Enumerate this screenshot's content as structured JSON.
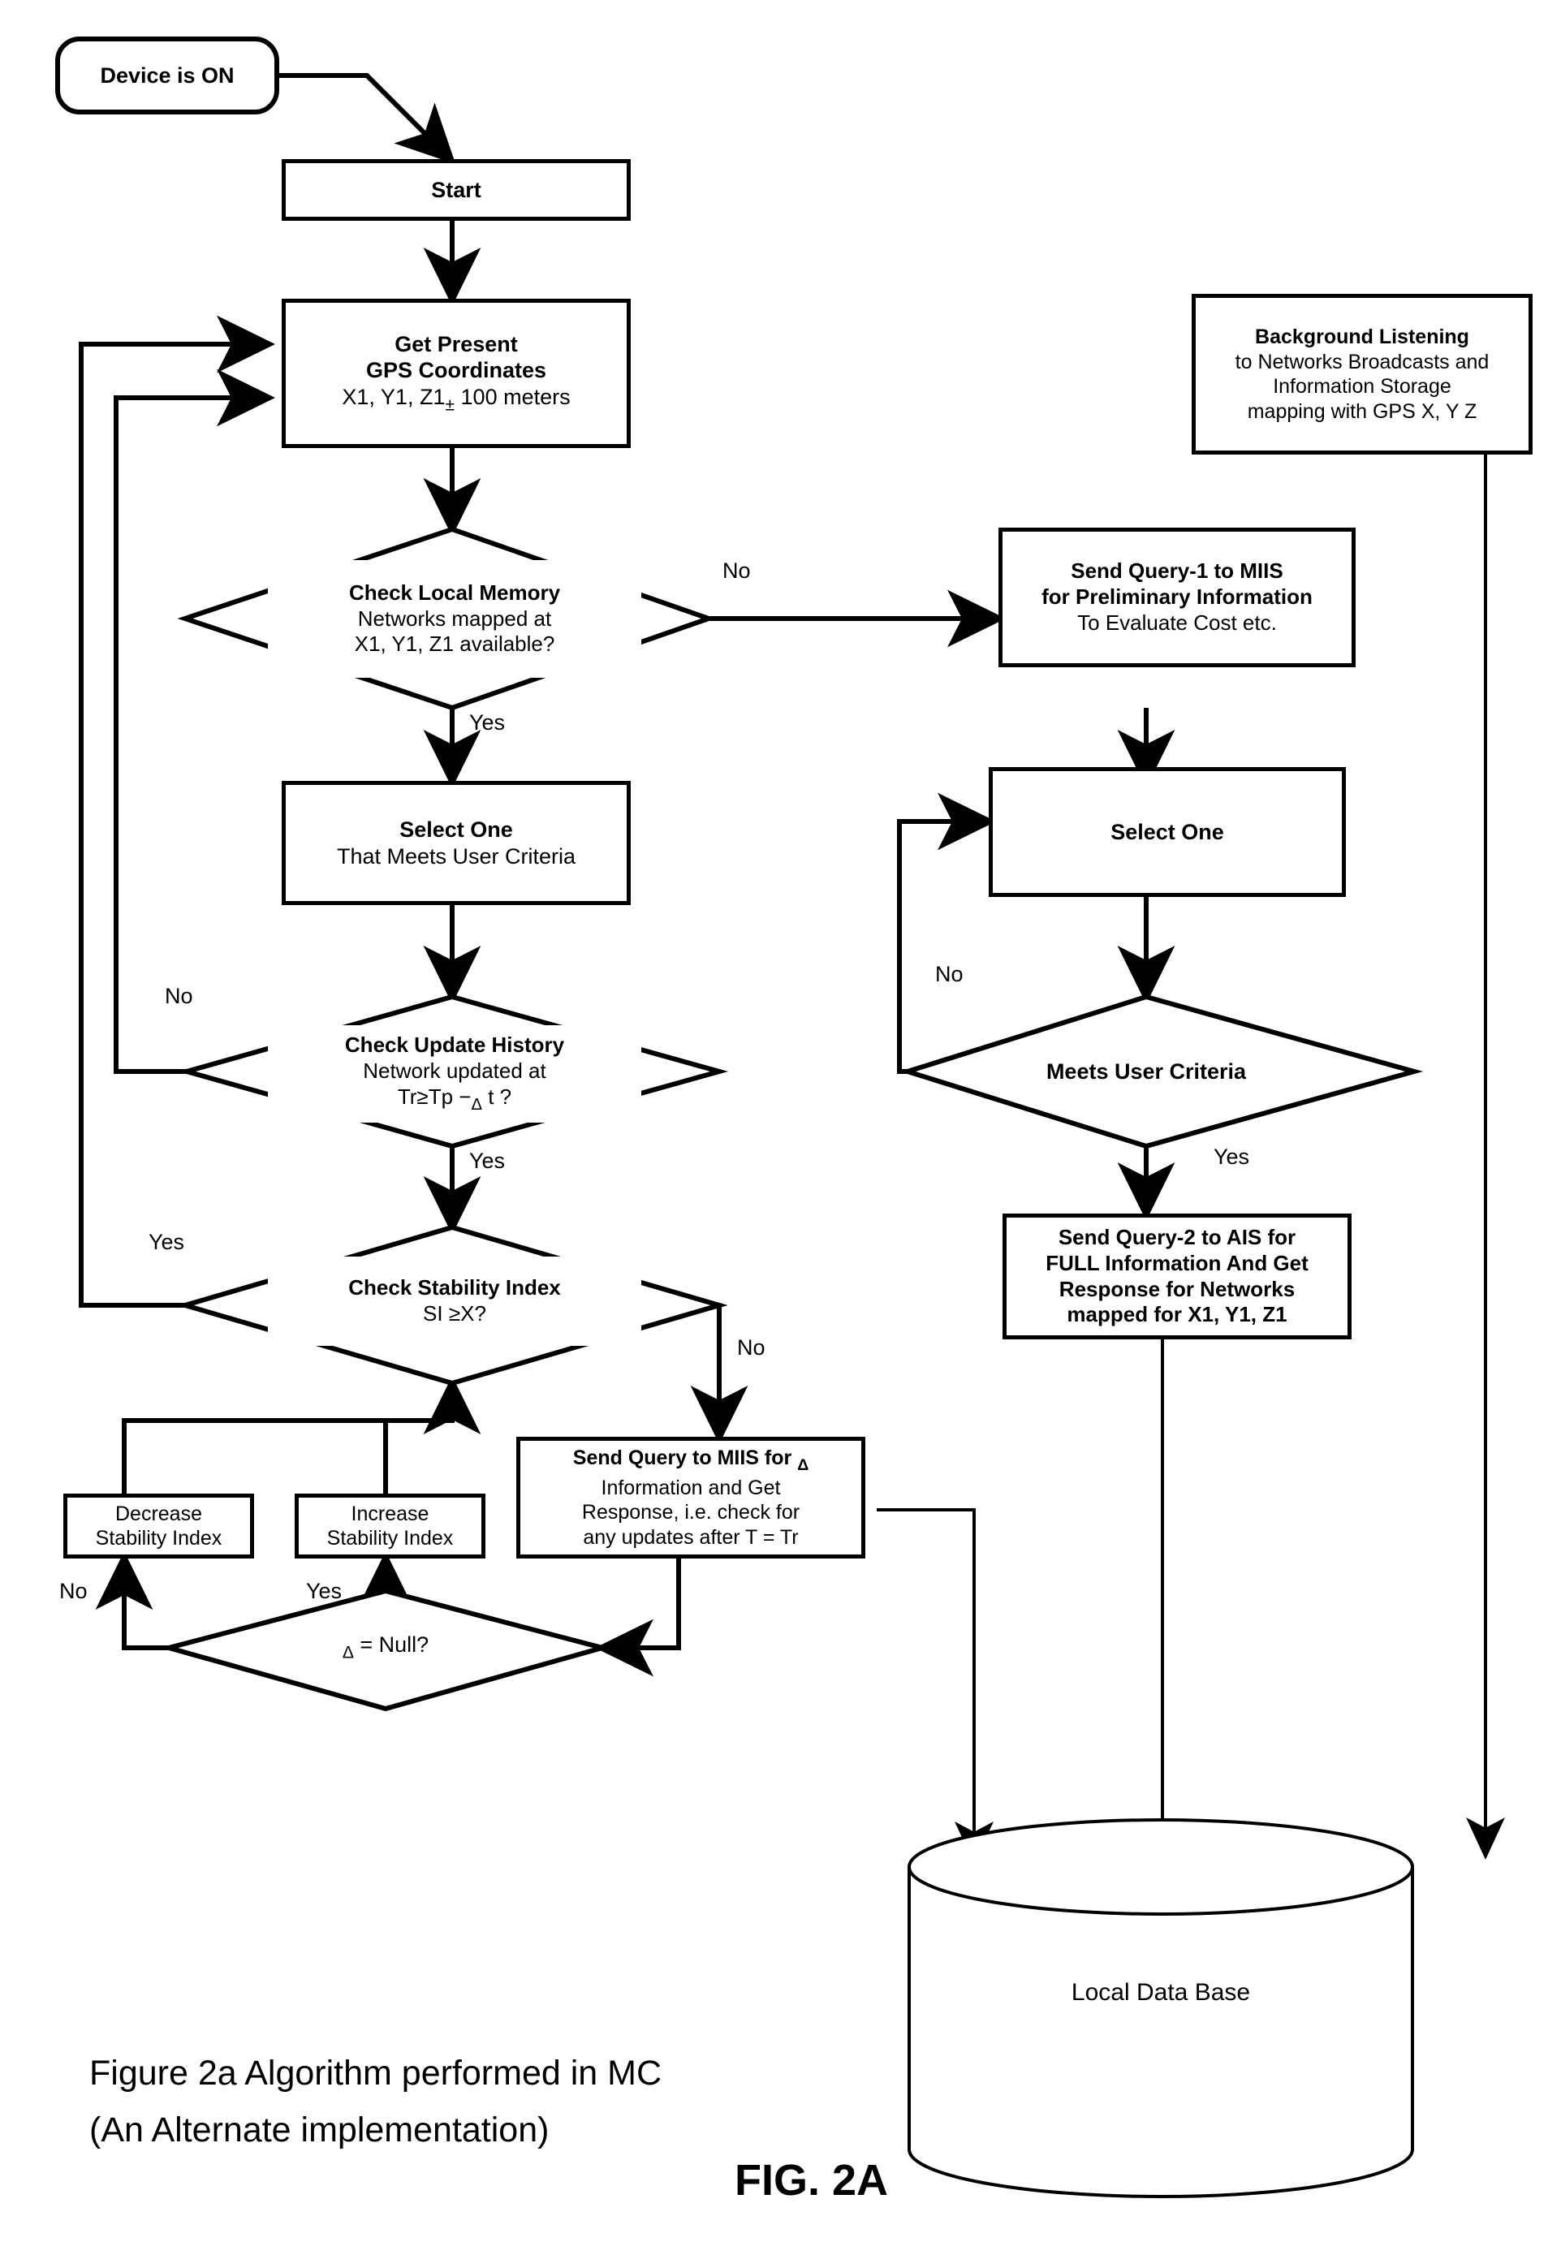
{
  "figure": {
    "caption_line1": "Figure 2a Algorithm performed in MC",
    "caption_line2": "(An Alternate implementation)",
    "fig_number": "FIG. 2A"
  },
  "nodes": {
    "device_on": {
      "label": "Device is ON",
      "shape": "terminator"
    },
    "start": {
      "label": "Start",
      "shape": "process"
    },
    "get_gps": {
      "line1": "Get Present",
      "line2": "GPS Coordinates",
      "line3_a": "X1, Y1, Z1",
      "line3_sym": "±",
      "line3_b": "100 meters",
      "shape": "process"
    },
    "check_local_memory": {
      "line1": "Check Local Memory",
      "line2": "Networks mapped at",
      "line3": "X1, Y1, Z1 available?",
      "shape": "decision"
    },
    "select_one_left": {
      "line1": "Select One",
      "line2": "That Meets User Criteria",
      "shape": "process"
    },
    "check_update_history": {
      "line1": "Check Update History",
      "line2": "Network updated at",
      "line3_a": "Tr",
      "line3_sym": "≥",
      "line3_b": "Tp −",
      "line3_delta": "Δ",
      "line3_c": "t ?",
      "shape": "decision"
    },
    "check_stability_index": {
      "line1": "Check Stability Index",
      "line2_a": "SI",
      "line2_sym": "≥",
      "line2_b": "X?",
      "shape": "decision"
    },
    "decrease_si": {
      "line1": "Decrease",
      "line2": "Stability Index",
      "shape": "process"
    },
    "increase_si": {
      "line1": "Increase",
      "line2": "Stability Index",
      "shape": "process"
    },
    "delta_null": {
      "delta": "Δ",
      "text": "= Null?",
      "shape": "decision"
    },
    "send_query_miis_delta": {
      "line1_a": "Send Query to MIIS for",
      "line1_delta": "Δ",
      "line2": "Information and Get",
      "line3": "Response, i.e. check for",
      "line4": "any updates after T = Tr",
      "shape": "process"
    },
    "background_listening": {
      "line1": "Background Listening",
      "line2": "to Networks Broadcasts and",
      "line3": "Information Storage",
      "line4": "mapping with GPS X, Y Z",
      "shape": "process"
    },
    "send_query_1": {
      "line1": "Send Query-1 to MIIS",
      "line2": "for Preliminary Information",
      "line3": "To Evaluate Cost etc.",
      "shape": "process"
    },
    "select_one_right": {
      "line1": "Select One",
      "shape": "process"
    },
    "meets_user_criteria": {
      "line1": "Meets User Criteria",
      "shape": "decision"
    },
    "send_query_2": {
      "line1": "Send Query-2 to AIS for",
      "line2": "FULL Information And Get",
      "line3": "Response for Networks",
      "line4": "mapped for X1, Y1, Z1",
      "shape": "process"
    },
    "local_database": {
      "label": "Local Data Base",
      "shape": "cylinder"
    }
  },
  "edge_labels": {
    "clm_no": "No",
    "clm_yes": "Yes",
    "cuh_no": "No",
    "cuh_yes": "Yes",
    "csi_yes": "Yes",
    "csi_no": "No",
    "delta_null_no": "No",
    "delta_null_yes": "Yes",
    "muc_no": "No",
    "muc_yes": "Yes"
  },
  "colors": {
    "stroke": "#000000",
    "background": "#ffffff"
  }
}
